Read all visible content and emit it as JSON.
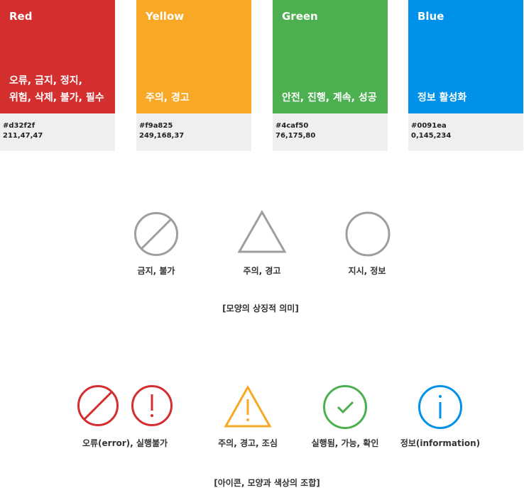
{
  "swatches": [
    {
      "name": "Red",
      "meaning": "오류, 금지, 정지,\n위험, 삭제, 불가, 필수",
      "hex": "#d32f2f",
      "rgb": "211,47,47",
      "color": "#d32f2f"
    },
    {
      "name": "Yellow",
      "meaning": "주의, 경고",
      "hex": "#f9a825",
      "rgb": "249,168,37",
      "color": "#f9a825"
    },
    {
      "name": "Green",
      "meaning": "안전, 진행, 계속, 성공",
      "hex": "#4caf50",
      "rgb": "76,175,80",
      "color": "#4caf50"
    },
    {
      "name": "Blue",
      "meaning": "정보 활성화",
      "hex": "#0091ea",
      "rgb": "0,145,234",
      "color": "#0091ea"
    }
  ],
  "shapes": {
    "items": [
      {
        "icon": "prohibition-circle-icon",
        "label": "금지, 불가"
      },
      {
        "icon": "triangle-icon",
        "label": "주의, 경고"
      },
      {
        "icon": "circle-icon",
        "label": "지시, 정보"
      }
    ],
    "caption": "[모양의 상징적 의미]",
    "color": "#9e9e9e"
  },
  "icons": {
    "items": [
      {
        "icons": [
          "prohibition-icon",
          "exclamation-circle-icon"
        ],
        "label": "오류(error), 실행불가",
        "color": "#d32f2f"
      },
      {
        "icons": [
          "warning-triangle-icon"
        ],
        "label": "주의, 경고, 조심",
        "color": "#f9a825"
      },
      {
        "icons": [
          "check-circle-icon"
        ],
        "label": "실행됨, 가능, 확인",
        "color": "#4caf50"
      },
      {
        "icons": [
          "info-circle-icon"
        ],
        "label": "정보(information)",
        "color": "#0091ea"
      }
    ],
    "caption": "[아이콘, 모양과 색상의 조합]"
  }
}
